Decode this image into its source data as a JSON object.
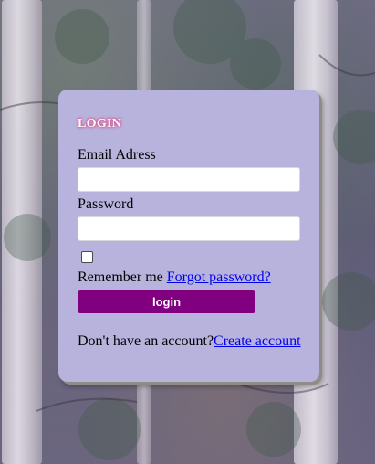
{
  "login_form": {
    "title": "LOGIN",
    "email_label": "Email Adress",
    "email_value": "",
    "password_label": "Password",
    "password_value": "",
    "remember_checked": false,
    "remember_label": "Remember me",
    "forgot_link": "Forgot password?",
    "login_button": "login",
    "signup_prompt": "Don't have an account?",
    "create_account_link": "Create account"
  },
  "colors": {
    "card_background": "#b7b3dc",
    "button_background": "#800080",
    "title_glow": "#e0337a",
    "link": "#0000ee"
  },
  "background": {
    "description_icon": "birch-forest-photo"
  }
}
